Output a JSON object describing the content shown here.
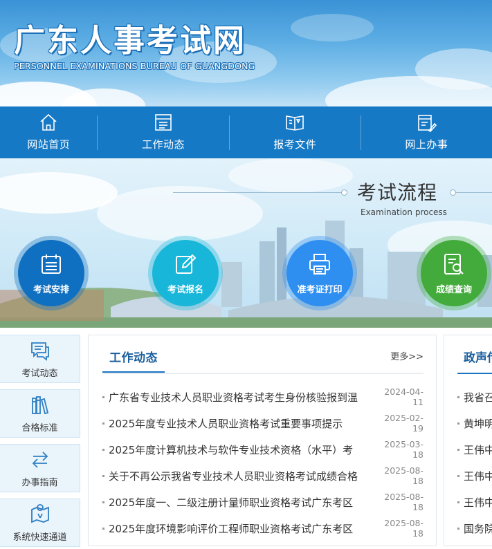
{
  "header": {
    "title": "广东人事考试网",
    "subtitle": "PERSONNEL EXAMINATIONS BUREAU OF GUANGDONG"
  },
  "nav": {
    "items": [
      {
        "label": "网站首页",
        "icon": "home-icon"
      },
      {
        "label": "工作动态",
        "icon": "news-list-icon"
      },
      {
        "label": "报考文件",
        "icon": "open-book-icon"
      },
      {
        "label": "网上办事",
        "icon": "online-service-icon"
      }
    ]
  },
  "process": {
    "title": "考试流程",
    "subtitle": "Examination process",
    "items": [
      {
        "label": "考试安排",
        "icon": "calendar-icon",
        "color": "#0f6fc0"
      },
      {
        "label": "考试报名",
        "icon": "edit-icon",
        "color": "#18b6d9"
      },
      {
        "label": "准考证打印",
        "icon": "printer-icon",
        "color": "#2e8ff0"
      },
      {
        "label": "成绩查询",
        "icon": "score-search-icon",
        "color": "#43ab3c"
      }
    ]
  },
  "sidebar": {
    "items": [
      {
        "label": "考试动态",
        "icon": "chat-icon"
      },
      {
        "label": "合格标准",
        "icon": "books-icon"
      },
      {
        "label": "办事指南",
        "icon": "swap-arrows-icon"
      },
      {
        "label": "系统快速通道",
        "icon": "map-pin-icon"
      }
    ]
  },
  "news": {
    "title": "工作动态",
    "more": "更多>>",
    "items": [
      {
        "text": "广东省专业技术人员职业资格考试考生身份核验报到温",
        "date": "2024-04-11"
      },
      {
        "text": "2025年度专业技术人员职业资格考试重要事项提示",
        "date": "2025-02-19"
      },
      {
        "text": "2025年度计算机技术与软件专业技术资格（水平）考",
        "date": "2025-03-18"
      },
      {
        "text": "关于不再公示我省专业技术人员职业资格考试成绩合格",
        "date": "2025-08-18"
      },
      {
        "text": "2025年度一、二级注册计量师职业资格考试广东考区",
        "date": "2025-08-18"
      },
      {
        "text": "2025年度环境影响评价工程师职业资格考试广东考区",
        "date": "2025-08-18"
      }
    ]
  },
  "policy": {
    "title": "政声传",
    "items": [
      {
        "text": "我省召"
      },
      {
        "text": "黄坤明"
      },
      {
        "text": "王伟中"
      },
      {
        "text": "王伟中"
      },
      {
        "text": "王伟中"
      },
      {
        "text": "国务院"
      }
    ]
  },
  "colors": {
    "nav_bg": "#1679c6",
    "title_blue": "#1a5e9c",
    "accent_blue": "#1a73c3"
  }
}
